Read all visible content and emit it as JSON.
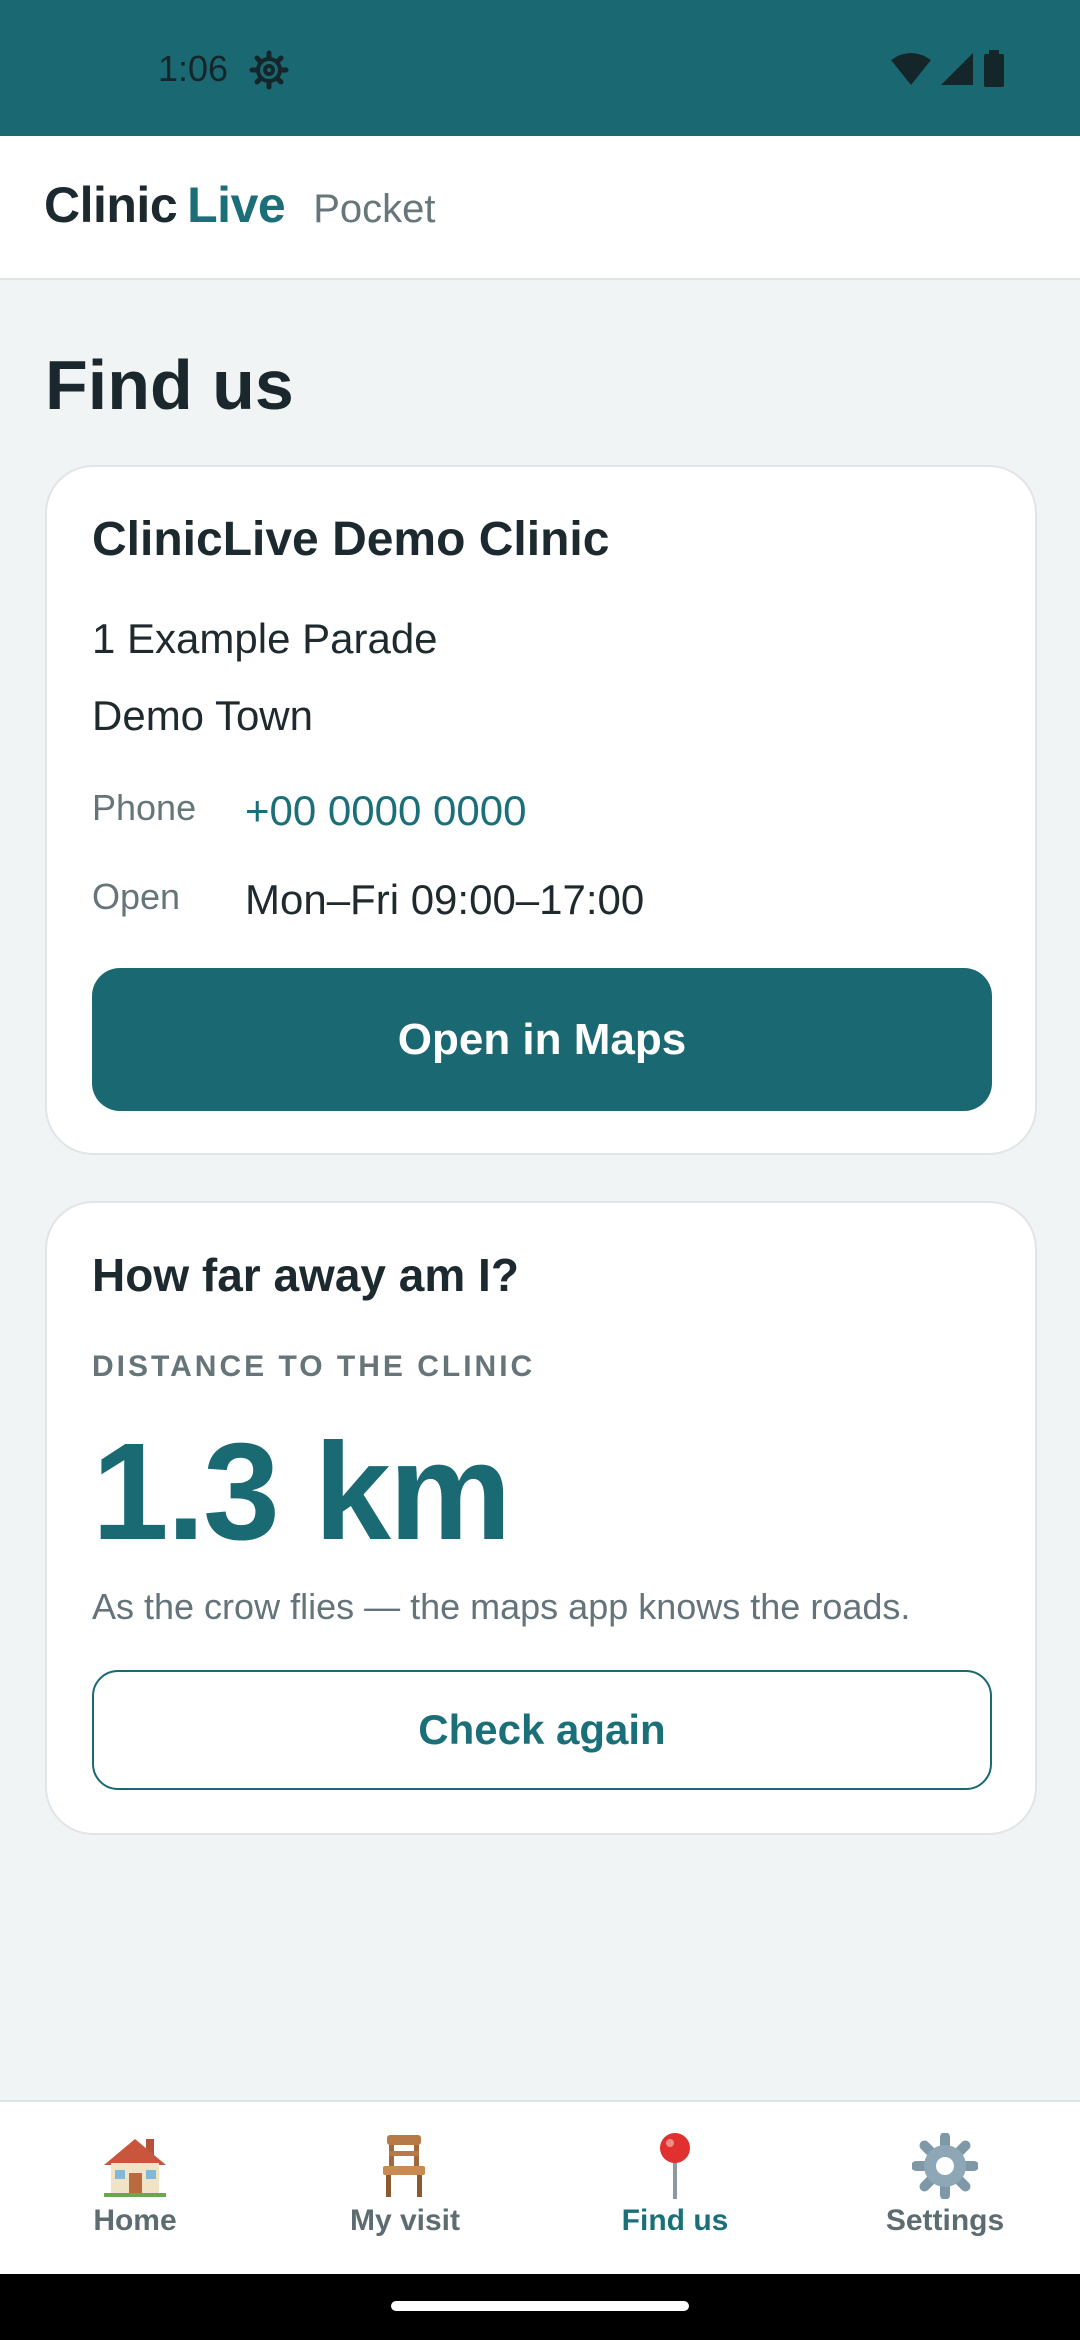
{
  "status_bar": {
    "time": "1:06",
    "background_color": "#1a6872",
    "icons": [
      "settings-gear-icon",
      "wifi-icon",
      "cellular-signal-icon",
      "battery-icon"
    ]
  },
  "app_bar": {
    "brand_clinic": "Clinic",
    "brand_live": "Live",
    "brand_suffix": "Pocket",
    "accent_color": "#1a6f79"
  },
  "page": {
    "title": "Find us"
  },
  "clinic_card": {
    "name": "ClinicLive Demo Clinic",
    "address_line1": "1 Example Parade",
    "address_line2": "Demo Town",
    "phone_label": "Phone",
    "phone_value": "+00 0000 0000",
    "open_label": "Open",
    "open_value": "Mon–Fri 09:00–17:00",
    "maps_button_label": "Open in Maps"
  },
  "distance_card": {
    "title": "How far away am I?",
    "label": "DISTANCE TO THE CLINIC",
    "value": "1.3 km",
    "note": "As the crow flies — the maps app knows the roads.",
    "check_button_label": "Check again"
  },
  "bottom_nav": {
    "items": [
      {
        "label": "Home",
        "icon": "house-icon",
        "active": false
      },
      {
        "label": "My visit",
        "icon": "chair-icon",
        "active": false
      },
      {
        "label": "Find us",
        "icon": "location-pin-icon",
        "active": true
      },
      {
        "label": "Settings",
        "icon": "gear-icon",
        "active": false
      }
    ]
  }
}
